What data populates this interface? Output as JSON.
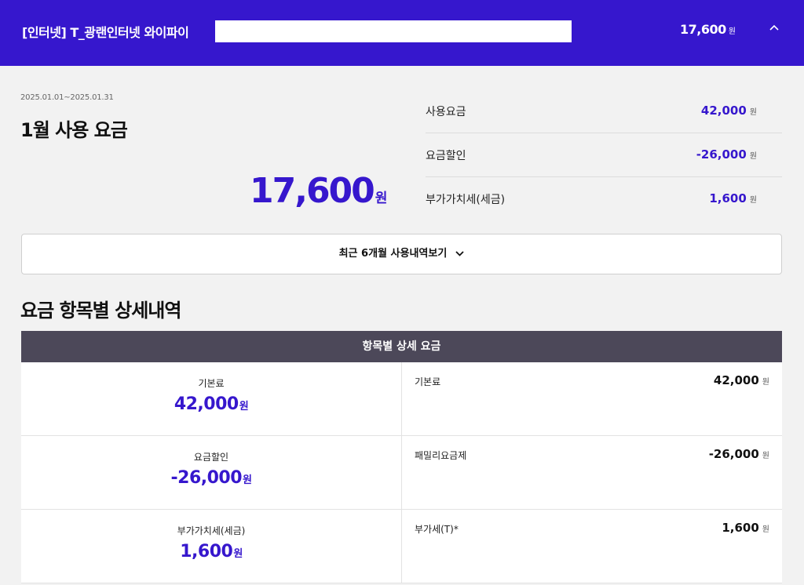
{
  "header": {
    "title": "[인터넷] T_광랜인터넷 와이파이",
    "amount": "17,600",
    "unit": "원",
    "collapse_icon": "chevron-up-icon"
  },
  "bill": {
    "period": "2025.01.01~2025.01.31",
    "title": "1월 사용 요금",
    "total": "17,600",
    "unit": "원"
  },
  "summary": [
    {
      "label": "사용요금",
      "value": "42,000",
      "unit": "원"
    },
    {
      "label": "요금할인",
      "value": "-26,000",
      "unit": "원"
    },
    {
      "label": "부가가치세(세금)",
      "value": "1,600",
      "unit": "원"
    }
  ],
  "history_button": {
    "label": "최근 6개월 사용내역보기",
    "icon": "chevron-down-icon"
  },
  "detail": {
    "section_title": "요금 항목별 상세내역",
    "table_header": "항목별 상세 요금",
    "rows": [
      {
        "category": "기본료",
        "category_value": "42,000",
        "item": "기본료",
        "item_value": "42,000"
      },
      {
        "category": "요금할인",
        "category_value": "-26,000",
        "item": "패밀리요금제",
        "item_value": "-26,000"
      },
      {
        "category": "부가가치세(세금)",
        "category_value": "1,600",
        "item": "부가세(T)*",
        "item_value": "1,600"
      }
    ],
    "unit": "원"
  },
  "colors": {
    "brand": "#3617cd",
    "table_header": "#4c4859",
    "background": "#f2f2f2"
  }
}
